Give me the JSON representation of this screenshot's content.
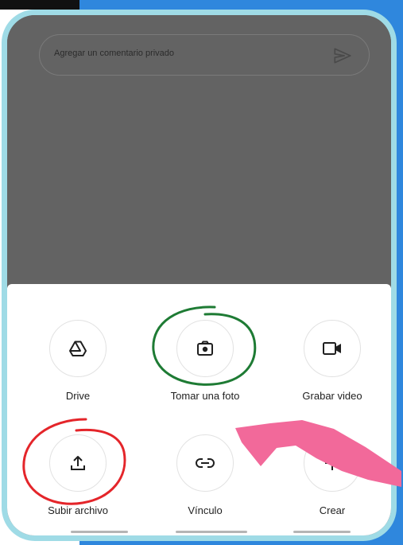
{
  "comment": {
    "placeholder": "Agregar un comentario privado",
    "send_icon": "send-icon"
  },
  "attach_options": [
    {
      "label": "Drive",
      "icon": "drive-icon"
    },
    {
      "label": "Tomar una foto",
      "icon": "camera-icon"
    },
    {
      "label": "Grabar video",
      "icon": "video-icon"
    },
    {
      "label": "Subir archivo",
      "icon": "upload-icon"
    },
    {
      "label": "Vínculo",
      "icon": "link-icon"
    },
    {
      "label": "Crear",
      "icon": "plus-icon"
    }
  ],
  "annotations": {
    "green_circle_color": "#1e7b34",
    "red_circle_color": "#e4252a",
    "arrow_color": "#f2699a"
  }
}
